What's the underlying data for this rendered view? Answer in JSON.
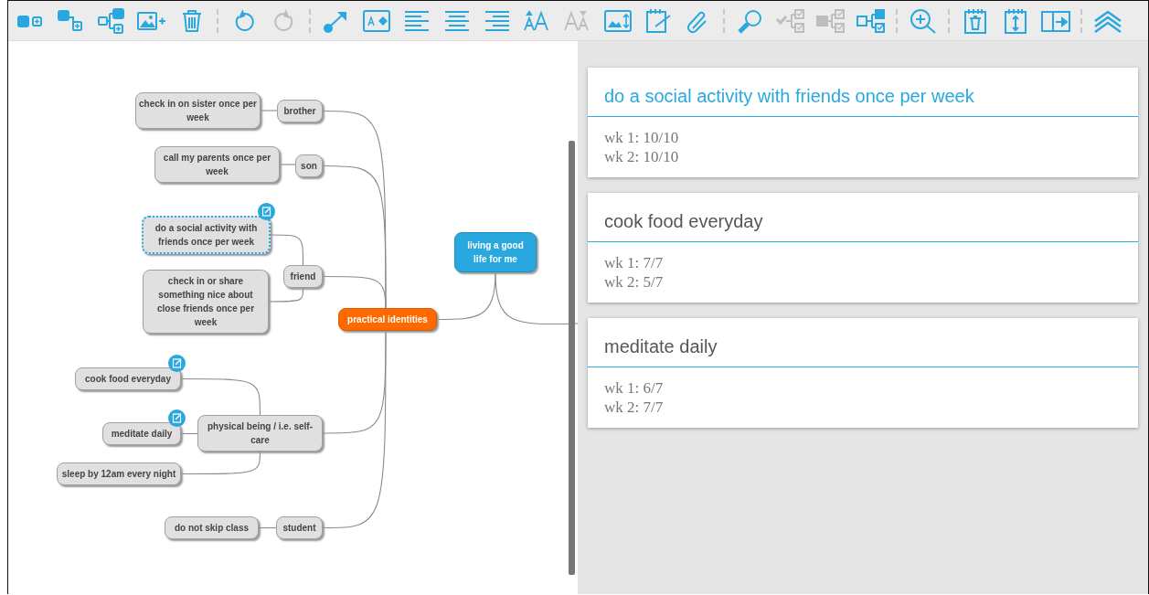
{
  "toolbar": {
    "buttons": [
      {
        "kind": "add-node",
        "disabled": false
      },
      {
        "kind": "add-child",
        "disabled": false
      },
      {
        "kind": "add-sibling",
        "disabled": false
      },
      {
        "kind": "add-image",
        "disabled": false
      },
      {
        "kind": "delete",
        "disabled": false
      },
      {
        "kind": "separator"
      },
      {
        "kind": "undo",
        "disabled": false
      },
      {
        "kind": "redo",
        "disabled": true
      },
      {
        "kind": "separator"
      },
      {
        "kind": "connect",
        "disabled": false
      },
      {
        "kind": "text-fill",
        "disabled": false
      },
      {
        "kind": "align-left",
        "disabled": false
      },
      {
        "kind": "align-center",
        "disabled": false
      },
      {
        "kind": "align-right",
        "disabled": false
      },
      {
        "kind": "font-larger",
        "disabled": false
      },
      {
        "kind": "font-smaller",
        "disabled": true
      },
      {
        "kind": "image-size",
        "disabled": false
      },
      {
        "kind": "note-edit",
        "disabled": false
      },
      {
        "kind": "attach",
        "disabled": false
      },
      {
        "kind": "separator"
      },
      {
        "kind": "search",
        "disabled": false
      },
      {
        "kind": "check-tree",
        "disabled": true
      },
      {
        "kind": "check-branch",
        "disabled": true
      },
      {
        "kind": "check-children",
        "disabled": false
      },
      {
        "kind": "separator"
      },
      {
        "kind": "zoom-in",
        "disabled": false
      },
      {
        "kind": "separator"
      },
      {
        "kind": "note-delete",
        "disabled": false
      },
      {
        "kind": "note-resize",
        "disabled": false
      },
      {
        "kind": "panel-toggle",
        "disabled": false
      },
      {
        "kind": "separator"
      },
      {
        "kind": "collapse",
        "disabled": false
      }
    ]
  },
  "mind_map": {
    "root": {
      "text": "living a good life for me",
      "kind": "central",
      "selected": false,
      "has_note": false,
      "children": [
        {
          "text": "practical identities",
          "kind": "main",
          "selected": false,
          "has_note": false,
          "children": [
            {
              "text": "brother",
              "kind": "topic",
              "selected": false,
              "has_note": false,
              "children": [
                {
                  "text": "check in on sister once per week",
                  "kind": "topic",
                  "selected": false,
                  "has_note": false
                }
              ]
            },
            {
              "text": "son",
              "kind": "topic",
              "selected": false,
              "has_note": false,
              "children": [
                {
                  "text": "call my parents once per week",
                  "kind": "topic",
                  "selected": false,
                  "has_note": false
                }
              ]
            },
            {
              "text": "friend",
              "kind": "topic",
              "selected": false,
              "has_note": false,
              "children": [
                {
                  "text": "do a social activity with friends once per week",
                  "kind": "topic",
                  "selected": true,
                  "has_note": true
                },
                {
                  "text": "check in or share something nice about close friends once per week",
                  "kind": "topic",
                  "selected": false,
                  "has_note": false
                }
              ]
            },
            {
              "text": "physical being / i.e. self-care",
              "kind": "topic",
              "selected": false,
              "has_note": false,
              "children": [
                {
                  "text": "cook food everyday",
                  "kind": "topic",
                  "selected": false,
                  "has_note": true
                },
                {
                  "text": "meditate daily",
                  "kind": "topic",
                  "selected": false,
                  "has_note": true
                },
                {
                  "text": "sleep by 12am every night",
                  "kind": "topic",
                  "selected": false,
                  "has_note": false
                }
              ]
            },
            {
              "text": "student",
              "kind": "topic",
              "selected": false,
              "has_note": false,
              "children": [
                {
                  "text": "do not skip class",
                  "kind": "topic",
                  "selected": false,
                  "has_note": false
                }
              ]
            }
          ]
        }
      ]
    }
  },
  "notes_panel": {
    "cards": [
      {
        "title": "do a social activity with friends once per week",
        "selected": true,
        "lines": [
          "wk 1: 10/10",
          "wk 2: 10/10"
        ]
      },
      {
        "title": "cook food everyday",
        "selected": false,
        "lines": [
          "wk 1: 7/7",
          "wk 2: 5/7"
        ]
      },
      {
        "title": "meditate daily",
        "selected": false,
        "lines": [
          "wk 1: 6/7",
          "wk 2: 7/7"
        ]
      }
    ]
  }
}
